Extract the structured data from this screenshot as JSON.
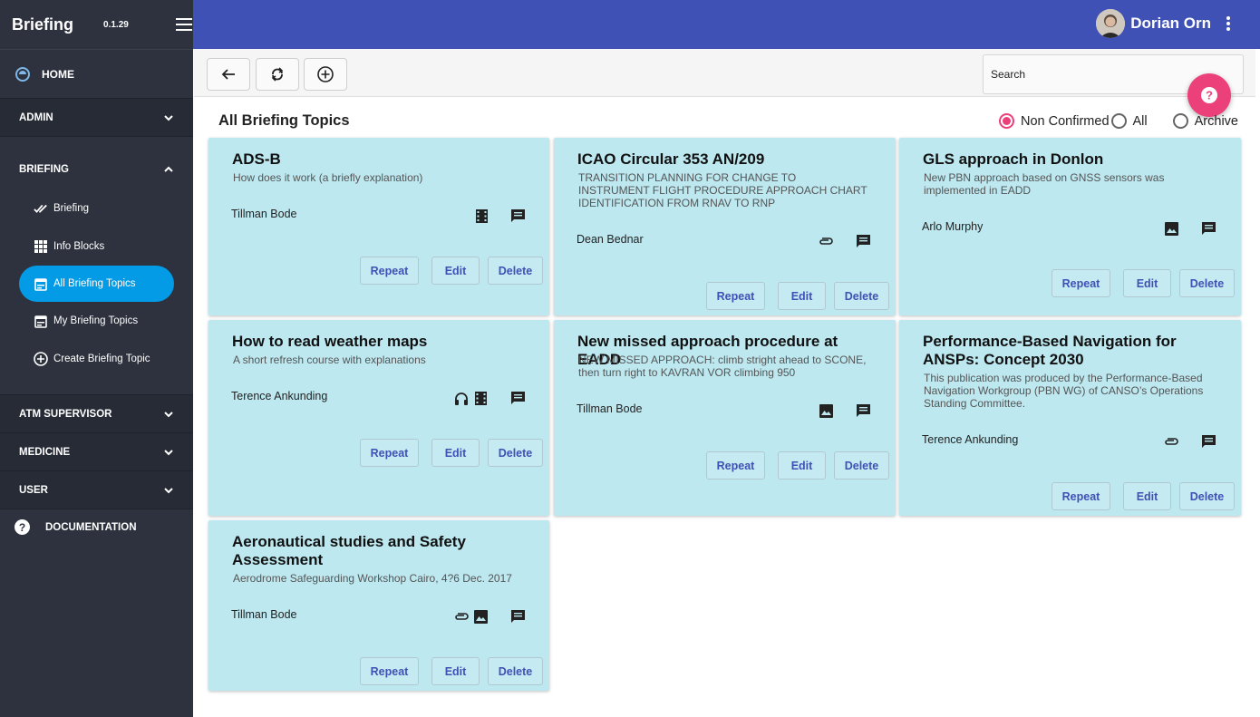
{
  "app": {
    "title": "Briefing",
    "version": "0.1.29"
  },
  "sidebar": {
    "home": "HOME",
    "admin": "ADMIN",
    "briefing": "BRIEFING",
    "briefing_items": [
      "Briefing",
      "Info Blocks",
      "All Briefing Topics",
      "My Briefing Topics",
      "Create Briefing Topic"
    ],
    "atm": "ATM SUPERVISOR",
    "medicine": "MEDICINE",
    "user": "USER",
    "documentation": "DOCUMENTATION"
  },
  "header": {
    "user_name": "Dorian Orn"
  },
  "toolbar": {
    "search_placeholder": "Search"
  },
  "page": {
    "title": "All Briefing Topics",
    "filters": [
      "Non Confirmed",
      "All",
      "Archive"
    ],
    "selected_filter": "Non Confirmed"
  },
  "actions": {
    "repeat": "Repeat",
    "edit": "Edit",
    "delete": "Delete"
  },
  "cards": [
    {
      "title": "ADS-B",
      "subtitle": "How does it work (a briefly explanation)",
      "author": "Tillman Bode",
      "icons": [
        "movie-icon"
      ]
    },
    {
      "title": "ICAO Circular 353 AN/209",
      "subtitle": "TRANSITION PLANNING FOR CHANGE TO INSTRUMENT FLIGHT PROCEDURE APPROACH CHART IDENTIFICATION FROM RNAV TO RNP",
      "author": "Dean Bednar",
      "icons": [
        "attachment-icon"
      ]
    },
    {
      "title": "GLS approach in Donlon",
      "subtitle": "New PBN approach based on GNSS sensors was implemented in EADD",
      "author": "Arlo Murphy",
      "icons": [
        "image-icon"
      ]
    },
    {
      "title": "How to read weather maps",
      "subtitle": "A short refresh course with explanations",
      "author": "Terence Ankunding",
      "icons": [
        "headset-icon",
        "movie-icon"
      ]
    },
    {
      "title": "New missed approach procedure at EADD",
      "subtitle": "NEW MISSED APPROACH: climb stright ahead to SCONE, then turn right to KAVRAN VOR climbing 950",
      "author": "Tillman Bode",
      "icons": [
        "image-icon"
      ]
    },
    {
      "title": "Performance-Based Navigation for ANSPs: Concept 2030",
      "subtitle": "This publication was produced by the Performance-Based Navigation Workgroup (PBN WG) of CANSO’s Operations Standing Committee.",
      "author": "Terence Ankunding",
      "icons": [
        "attachment-icon"
      ]
    },
    {
      "title": "Aeronautical studies and Safety Assessment",
      "subtitle": "Aerodrome Safeguarding Workshop Cairo, 4?6 Dec. 2017",
      "author": "Tillman Bode",
      "icons": [
        "attachment-icon",
        "image-icon"
      ]
    }
  ],
  "colors": {
    "sidebar": "#2d323e",
    "topbar": "#3f51b5",
    "active": "#039be5",
    "card": "#bde8f0",
    "accent": "#ec407a"
  }
}
